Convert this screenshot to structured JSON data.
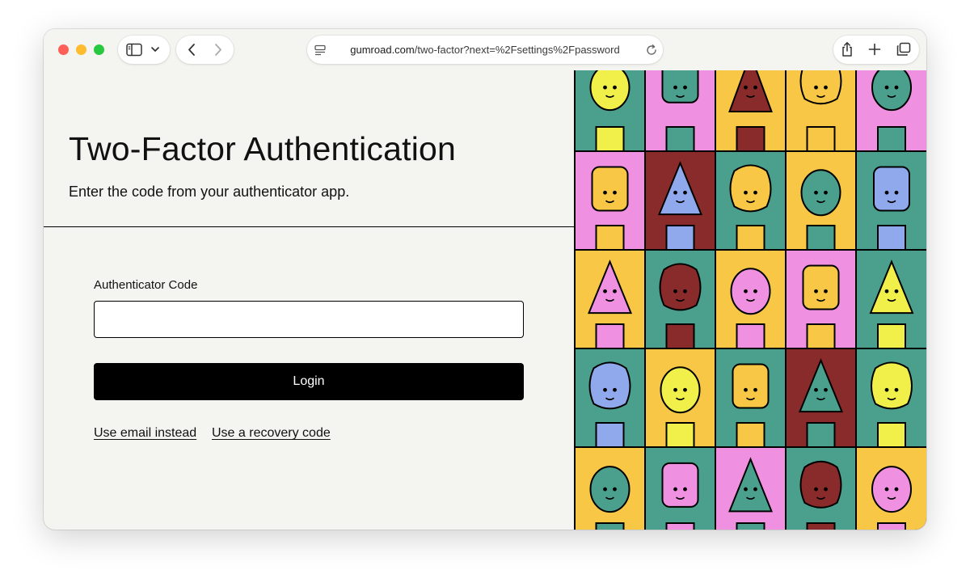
{
  "browser": {
    "url_host": "gumroad.com",
    "url_path": "/two-factor?next=%2Fsettings%2Fpassword",
    "icons": {
      "close": "traffic-light-red",
      "minimize": "traffic-light-yellow",
      "zoom": "traffic-light-green",
      "sidebar": "sidebar-icon",
      "chevron": "chevron-down-icon",
      "back": "back-icon",
      "forward": "forward-icon",
      "page_settings": "page-settings-icon",
      "reload": "reload-icon",
      "share": "share-icon",
      "new_tab": "plus-icon",
      "tabs": "tab-overview-icon"
    }
  },
  "page": {
    "title": "Two-Factor Authentication",
    "subtitle": "Enter the code from your authenticator app.",
    "form": {
      "code_label": "Authenticator Code",
      "code_value": "",
      "login_label": "Login"
    },
    "links": {
      "email": "Use email instead",
      "recovery": "Use a recovery code"
    }
  },
  "illustration": {
    "palette": {
      "yellow": "#f7c745",
      "pink": "#f090e0",
      "teal": "#4ba08d",
      "maroon": "#8a2b2b",
      "lime": "#f1f04a",
      "lavender": "#90a8ec",
      "black": "#000000"
    },
    "grid": [
      [
        "teal",
        "pink",
        "yellow",
        "yellow",
        "pink"
      ],
      [
        "pink",
        "maroon",
        "teal",
        "yellow",
        "teal"
      ],
      [
        "yellow",
        "teal",
        "yellow",
        "pink",
        "teal"
      ],
      [
        "teal",
        "yellow",
        "teal",
        "maroon",
        "teal"
      ],
      [
        "yellow",
        "teal",
        "pink",
        "teal",
        "yellow"
      ]
    ],
    "characters": [
      [
        "lime",
        "teal",
        "maroon",
        "yellow",
        "teal"
      ],
      [
        "yellow",
        "lavender",
        "yellow",
        "teal",
        "lavender"
      ],
      [
        "pink",
        "maroon",
        "pink",
        "yellow",
        "lime"
      ],
      [
        "lavender",
        "lime",
        "yellow",
        "teal",
        "lime"
      ],
      [
        "teal",
        "pink",
        "teal",
        "maroon",
        "pink"
      ]
    ]
  }
}
